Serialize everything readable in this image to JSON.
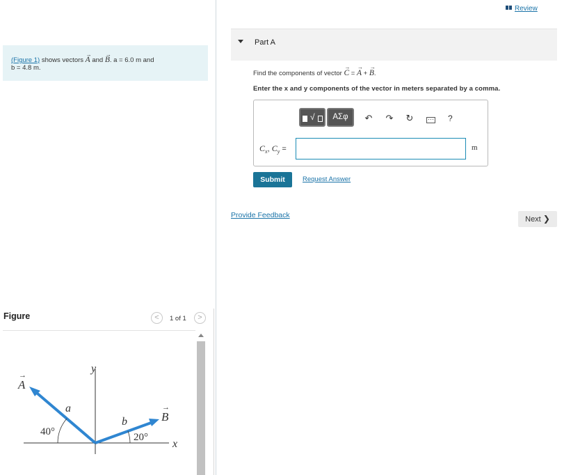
{
  "intro": {
    "figure_link": "(Figure 1)",
    "text_pre": "shows vectors",
    "vec_a": "A",
    "text_and": "and",
    "vec_b": "B",
    "text_a_val": ". a = 6.0 m and",
    "text_b_val": "b = 4.8 m."
  },
  "figure": {
    "header": "Figure",
    "page_count": "1 of 1",
    "prev_label": "<",
    "next_label": ">",
    "labels": {
      "y_axis": "y",
      "x_axis": "x",
      "vec_a": "A",
      "vec_b": "B",
      "a": "a",
      "b": "b",
      "angle_a": "40°",
      "angle_b": "20°"
    }
  },
  "header": {
    "review_label": "Review"
  },
  "part": {
    "title": "Part A",
    "question_pre": "Find the components of vector",
    "vec_c": "C",
    "eq": "=",
    "vec_a": "A",
    "plus": "+",
    "vec_b": "B",
    "period": ".",
    "instruction": "Enter the x and y components of the vector in meters separated by a comma."
  },
  "toolbar": {
    "templates_label": "√",
    "greek_label": "ΑΣφ",
    "undo_symbol": "↶",
    "redo_symbol": "↷",
    "reset_symbol": "↻",
    "help_symbol": "?"
  },
  "answer": {
    "label_cx": "C",
    "sub_x": "x",
    "comma": ",",
    "label_cy": "C",
    "sub_y": "y",
    "eq": "=",
    "value": "",
    "unit": "m"
  },
  "actions": {
    "submit_label": "Submit",
    "request_label": "Request Answer",
    "feedback_label": "Provide Feedback",
    "next_label": "Next",
    "next_chevron": "❯"
  },
  "colors": {
    "vector": "#2f86d1",
    "link": "#1a73a8",
    "submit": "#1a7497",
    "intro_bg": "#e6f3f6"
  }
}
